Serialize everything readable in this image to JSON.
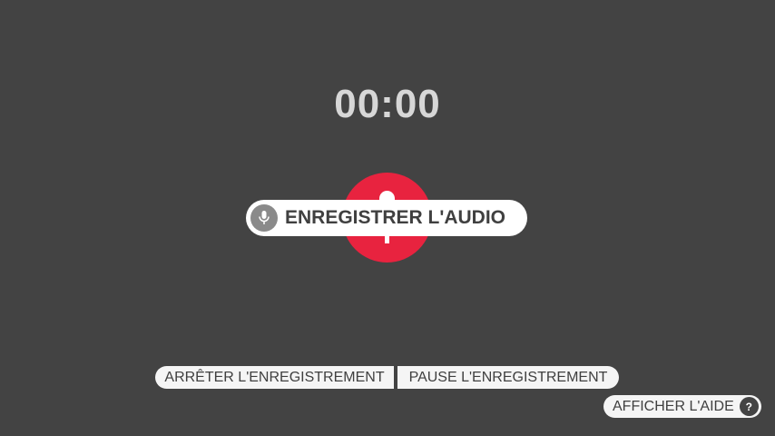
{
  "timer": {
    "value": "00:00"
  },
  "record": {
    "label": "ENREGISTRER L'AUDIO",
    "icon": "microphone-icon",
    "accent_color": "#e8233f"
  },
  "controls": {
    "stop_label": "ARRÊTER L'ENREGISTREMENT",
    "pause_label": "PAUSE L'ENREGISTREMENT"
  },
  "help": {
    "label": "AFFICHER L'AIDE",
    "icon_glyph": "?",
    "icon": "help-icon"
  }
}
